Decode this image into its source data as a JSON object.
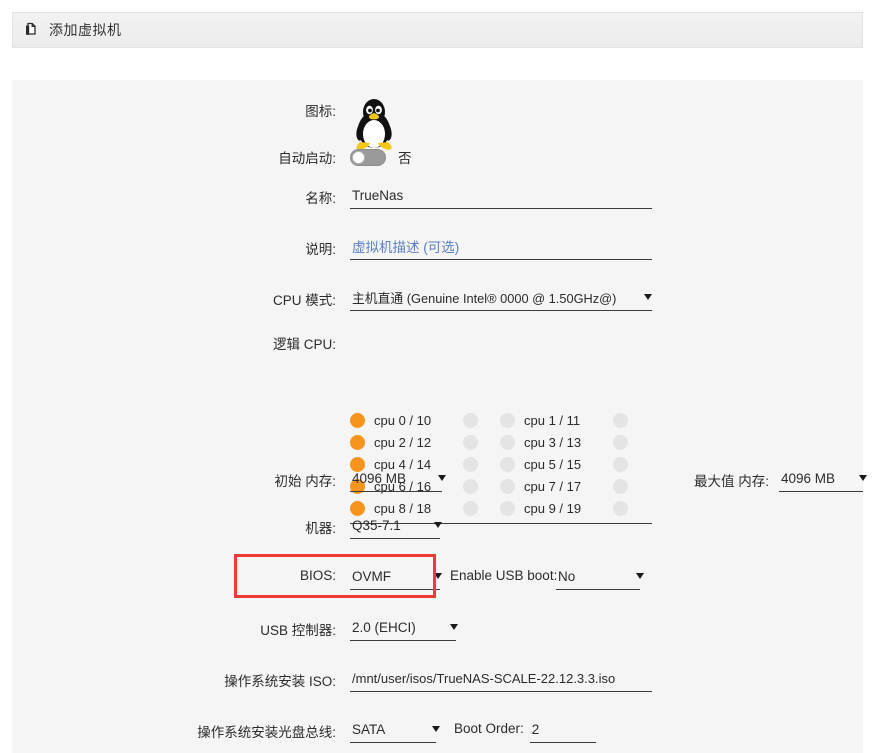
{
  "window": {
    "title": "添加虚拟机",
    "icon": "copy-pages-icon"
  },
  "form": {
    "icon": {
      "label": "图标:",
      "image": "tux-penguin-icon"
    },
    "autostart": {
      "label": "自动启动:",
      "state_text": "否",
      "enabled": false
    },
    "name": {
      "label": "名称:",
      "value": "TrueNas"
    },
    "description": {
      "label": "说明:",
      "placeholder": "虚拟机描述 (可选)",
      "value": ""
    },
    "cpu_mode": {
      "label": "CPU 模式:",
      "value": "主机直通 (Genuine Intel® 0000 @ 1.50GHz@)"
    },
    "logical_cpu": {
      "label": "逻辑 CPU:",
      "rows": [
        {
          "c0_on": true,
          "c0_label": "cpu 0 / 10",
          "c1_on": false,
          "c2_on": false,
          "c2_label": "cpu 1 / 11",
          "c3_on": false
        },
        {
          "c0_on": true,
          "c0_label": "cpu 2 / 12",
          "c1_on": false,
          "c2_on": false,
          "c2_label": "cpu 3 / 13",
          "c3_on": false
        },
        {
          "c0_on": true,
          "c0_label": "cpu 4 / 14",
          "c1_on": false,
          "c2_on": false,
          "c2_label": "cpu 5 / 15",
          "c3_on": false
        },
        {
          "c0_on": true,
          "c0_label": "cpu 6 / 16",
          "c1_on": false,
          "c2_on": false,
          "c2_label": "cpu 7 / 17",
          "c3_on": false
        },
        {
          "c0_on": true,
          "c0_label": "cpu 8 / 18",
          "c1_on": false,
          "c2_on": false,
          "c2_label": "cpu 9 / 19",
          "c3_on": false
        }
      ]
    },
    "initial_memory": {
      "label": "初始 内存:",
      "value": "4096 MB"
    },
    "max_memory": {
      "label": "最大值 内存:",
      "value": "4096 MB"
    },
    "machine": {
      "label": "机器:",
      "value": "Q35-7.1"
    },
    "bios": {
      "label": "BIOS:",
      "value": "OVMF",
      "highlight_color": "#ef3b36"
    },
    "usb_boot": {
      "label": "Enable USB boot:",
      "value": "No"
    },
    "usb_controller": {
      "label": "USB 控制器:",
      "value": "2.0 (EHCI)"
    },
    "os_install_iso": {
      "label": "操作系统安装 ISO:",
      "value": "/mnt/user/isos/TrueNAS-SCALE-22.12.3.3.iso"
    },
    "os_install_bus": {
      "label": "操作系统安装光盘总线:",
      "value": "SATA"
    },
    "boot_order": {
      "label": "Boot Order:",
      "value": "2"
    }
  },
  "colors": {
    "cpu_selected": "#f7941e",
    "cpu_unselected": "#e4e4e4",
    "highlight": "#ef3b36",
    "link": "#5b7fc4",
    "panel_bg": "#f5f5f5"
  }
}
